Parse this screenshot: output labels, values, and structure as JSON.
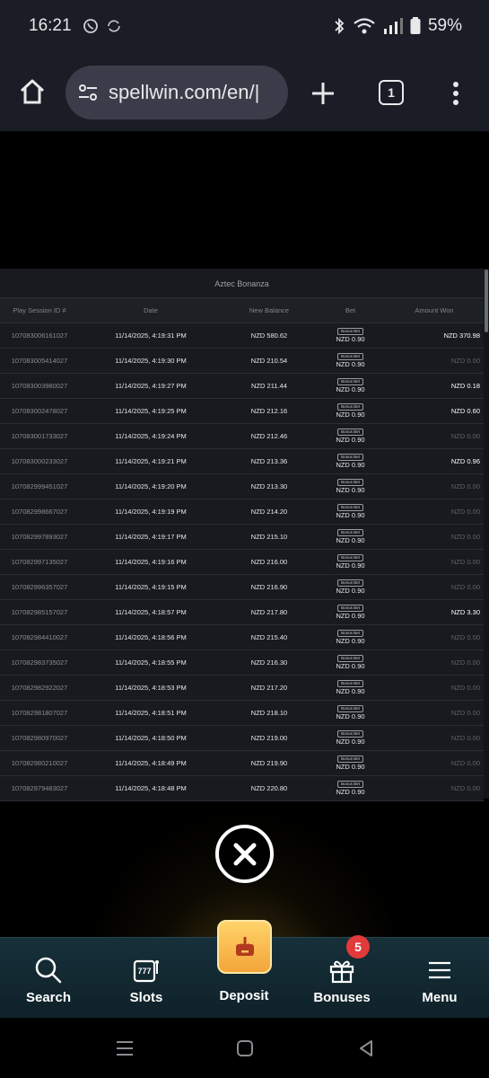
{
  "status_bar": {
    "time": "16:21",
    "battery": "59%"
  },
  "browser": {
    "url": "spellwin.com/en/|",
    "tab_count": "1"
  },
  "table": {
    "title": "Aztec Bonanza",
    "headers": [
      "Play Session ID #",
      "Date",
      "New Balance",
      "Bet",
      "Amount Won"
    ],
    "rows": [
      {
        "id": "107083006161027",
        "date": "11/14/2025, 4:19:31 PM",
        "balance": "NZD 580.62",
        "badge": "Bonus Bet",
        "bet": "NZD 0.90",
        "won": "NZD 370.98"
      },
      {
        "id": "107083005414027",
        "date": "11/14/2025, 4:19:30 PM",
        "balance": "NZD 210.54",
        "badge": "Bonus Bet",
        "bet": "NZD 0.90",
        "won": "NZD 0.00"
      },
      {
        "id": "107083003980027",
        "date": "11/14/2025, 4:19:27 PM",
        "balance": "NZD 211.44",
        "badge": "Bonus Bet",
        "bet": "NZD 0.90",
        "won": "NZD 0.18"
      },
      {
        "id": "107083002478027",
        "date": "11/14/2025, 4:19:25 PM",
        "balance": "NZD 212.16",
        "badge": "Bonus Bet",
        "bet": "NZD 0.90",
        "won": "NZD 0.60"
      },
      {
        "id": "107083001733027",
        "date": "11/14/2025, 4:19:24 PM",
        "balance": "NZD 212.46",
        "badge": "Bonus Bet",
        "bet": "NZD 0.90",
        "won": "NZD 0.00"
      },
      {
        "id": "107083000233027",
        "date": "11/14/2025, 4:19:21 PM",
        "balance": "NZD 213.36",
        "badge": "Bonus Bet",
        "bet": "NZD 0.90",
        "won": "NZD 0.96"
      },
      {
        "id": "107082999451027",
        "date": "11/14/2025, 4:19:20 PM",
        "balance": "NZD 213.30",
        "badge": "Bonus Bet",
        "bet": "NZD 0.90",
        "won": "NZD 0.00"
      },
      {
        "id": "107082998667027",
        "date": "11/14/2025, 4:19:19 PM",
        "balance": "NZD 214.20",
        "badge": "Bonus Bet",
        "bet": "NZD 0.90",
        "won": "NZD 0.00"
      },
      {
        "id": "107082997893027",
        "date": "11/14/2025, 4:19:17 PM",
        "balance": "NZD 215.10",
        "badge": "Bonus Bet",
        "bet": "NZD 0.90",
        "won": "NZD 0.00"
      },
      {
        "id": "107082997135027",
        "date": "11/14/2025, 4:19:16 PM",
        "balance": "NZD 216.00",
        "badge": "Bonus Bet",
        "bet": "NZD 0.90",
        "won": "NZD 0.00"
      },
      {
        "id": "107082996357027",
        "date": "11/14/2025, 4:19:15 PM",
        "balance": "NZD 216.90",
        "badge": "Bonus Bet",
        "bet": "NZD 0.90",
        "won": "NZD 0.00"
      },
      {
        "id": "107082985157027",
        "date": "11/14/2025, 4:18:57 PM",
        "balance": "NZD 217.80",
        "badge": "Bonus Bet",
        "bet": "NZD 0.90",
        "won": "NZD 3.30"
      },
      {
        "id": "107082984410027",
        "date": "11/14/2025, 4:18:56 PM",
        "balance": "NZD 215.40",
        "badge": "Bonus Bet",
        "bet": "NZD 0.90",
        "won": "NZD 0.00"
      },
      {
        "id": "107082983735027",
        "date": "11/14/2025, 4:18:55 PM",
        "balance": "NZD 216.30",
        "badge": "Bonus Bet",
        "bet": "NZD 0.90",
        "won": "NZD 0.00"
      },
      {
        "id": "107082982922027",
        "date": "11/14/2025, 4:18:53 PM",
        "balance": "NZD 217.20",
        "badge": "Bonus Bet",
        "bet": "NZD 0.90",
        "won": "NZD 0.00"
      },
      {
        "id": "107082981807027",
        "date": "11/14/2025, 4:18:51 PM",
        "balance": "NZD 218.10",
        "badge": "Bonus Bet",
        "bet": "NZD 0.90",
        "won": "NZD 0.00"
      },
      {
        "id": "107082980970027",
        "date": "11/14/2025, 4:18:50 PM",
        "balance": "NZD 219.00",
        "badge": "Bonus Bet",
        "bet": "NZD 0.90",
        "won": "NZD 0.00"
      },
      {
        "id": "107082980210027",
        "date": "11/14/2025, 4:18:49 PM",
        "balance": "NZD 219.90",
        "badge": "Bonus Bet",
        "bet": "NZD 0.90",
        "won": "NZD 0.00"
      },
      {
        "id": "107082979483027",
        "date": "11/14/2025, 4:18:48 PM",
        "balance": "NZD 220.80",
        "badge": "Bonus Bet",
        "bet": "NZD 0.90",
        "won": "NZD 0.00"
      }
    ]
  },
  "bottom_nav": {
    "search": "Search",
    "slots": "Slots",
    "deposit": "Deposit",
    "bonuses": "Bonuses",
    "bonuses_badge": "5",
    "menu": "Menu"
  },
  "icons": {
    "home": "home-icon",
    "tune": "tune-icon",
    "plus": "plus-icon",
    "more": "more-vert-icon",
    "close": "close-icon",
    "search": "search-icon",
    "slots": "slot-machine-icon",
    "deposit": "deposit-icon",
    "bonuses": "gift-icon",
    "menu": "hamburger-icon"
  },
  "colors": {
    "accent": "#f3a53a",
    "badge": "#e23a3a",
    "nav_bg": "#16303a"
  }
}
